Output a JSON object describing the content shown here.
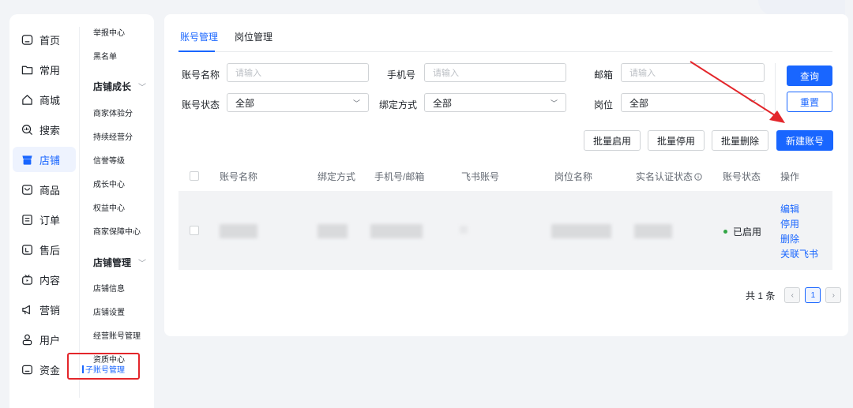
{
  "sidebar": {
    "items": [
      {
        "label": "首页",
        "icon": "home-icon"
      },
      {
        "label": "常用",
        "icon": "folder-icon"
      },
      {
        "label": "商城",
        "icon": "house-icon"
      },
      {
        "label": "搜索",
        "icon": "search-chart-icon"
      },
      {
        "label": "店铺",
        "icon": "shop-icon",
        "active": true
      },
      {
        "label": "商品",
        "icon": "product-icon"
      },
      {
        "label": "订单",
        "icon": "order-icon"
      },
      {
        "label": "售后",
        "icon": "after-sale-icon"
      },
      {
        "label": "内容",
        "icon": "tv-icon"
      },
      {
        "label": "营销",
        "icon": "megaphone-icon"
      },
      {
        "label": "用户",
        "icon": "user-icon"
      },
      {
        "label": "资金",
        "icon": "wallet-icon"
      }
    ],
    "active_color": "#1966ff"
  },
  "subnav": {
    "top_items": [
      "举报中心",
      "黑名单"
    ],
    "groups": [
      {
        "title": "店铺成长",
        "items": [
          "商家体验分",
          "持续经营分",
          "信誉等级",
          "成长中心",
          "权益中心",
          "商家保障中心"
        ]
      },
      {
        "title": "店铺管理",
        "items": [
          "店铺信息",
          "店铺设置",
          "经营账号管理",
          "资质中心"
        ]
      }
    ],
    "active_item": "子账号管理"
  },
  "tabs": [
    {
      "label": "账号管理",
      "active": true
    },
    {
      "label": "岗位管理",
      "active": false
    }
  ],
  "filters": {
    "account_name": {
      "label": "账号名称",
      "placeholder": "请输入"
    },
    "phone": {
      "label": "手机号",
      "placeholder": "请输入"
    },
    "email": {
      "label": "邮箱",
      "placeholder": "请输入"
    },
    "account_status": {
      "label": "账号状态",
      "value": "全部"
    },
    "bind_method": {
      "label": "绑定方式",
      "value": "全部"
    },
    "position": {
      "label": "岗位",
      "value": "全部"
    }
  },
  "buttons": {
    "query": "查询",
    "reset": "重置",
    "batch_enable": "批量启用",
    "batch_disable": "批量停用",
    "batch_delete": "批量删除",
    "new_account": "新建账号"
  },
  "table": {
    "columns": [
      "账号名称",
      "绑定方式",
      "手机号/邮箱",
      "飞书账号",
      "岗位名称",
      "实名认证状态",
      "账号状态",
      "操作"
    ],
    "rows": [
      {
        "status": "已启用",
        "actions": [
          "编辑",
          "停用",
          "删除",
          "关联飞书"
        ]
      }
    ]
  },
  "pagination": {
    "total_text": "共 1 条",
    "current_page": "1"
  },
  "colors": {
    "primary": "#1966ff",
    "annotation_red": "#e3262b",
    "status_green": "#32a645"
  }
}
